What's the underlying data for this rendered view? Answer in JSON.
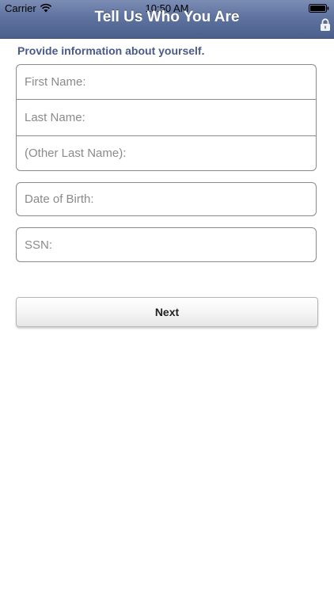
{
  "status_bar": {
    "carrier": "Carrier",
    "time": "10:50 AM",
    "wifi_icon": "wifi-icon",
    "battery_icon": "battery-icon"
  },
  "header": {
    "title": "Tell Us Who You Are",
    "lock_icon": "lock-icon",
    "colors": {
      "gradient_top": "#7c8db4",
      "gradient_bottom": "#4b5f8d"
    }
  },
  "form": {
    "instructions": "Provide information about yourself.",
    "fields": {
      "first_name": {
        "placeholder": "First Name:",
        "value": ""
      },
      "last_name": {
        "placeholder": "Last Name:",
        "value": ""
      },
      "other_last_name": {
        "placeholder": "(Other Last Name):",
        "value": ""
      },
      "date_of_birth": {
        "placeholder": "Date of Birth:",
        "value": ""
      },
      "ssn": {
        "placeholder": "SSN:",
        "value": ""
      }
    },
    "next_label": "Next"
  },
  "colors": {
    "instruction_text": "#4a5a86",
    "field_border": "#8a8a8a",
    "placeholder": "#8a8a8a"
  }
}
